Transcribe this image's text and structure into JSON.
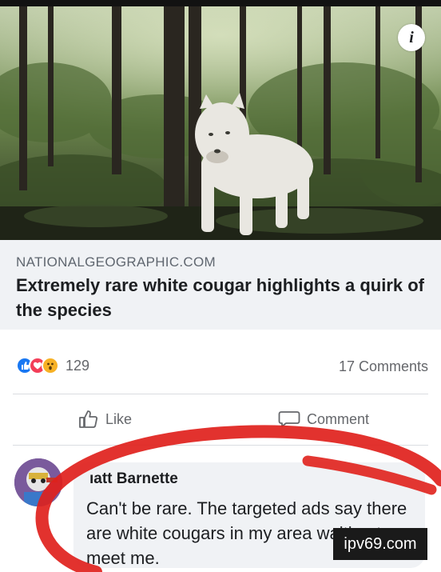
{
  "post": {
    "info_icon": "info-icon",
    "link": {
      "domain": "NATIONALGEOGRAPHIC.COM",
      "headline": "Extremely rare white cougar highlights a quirk of the species"
    },
    "reactions": {
      "icons": [
        "like-icon",
        "love-icon",
        "wow-icon"
      ],
      "count": "129"
    },
    "comments_count": "17 Comments",
    "actions": {
      "like_label": "Like",
      "comment_label": "Comment"
    }
  },
  "comment": {
    "author": "Matt Barnette",
    "author_visible": "ıatt Barnette",
    "text": "Can't be rare. The targeted ads say there are white cougars in my area waiting to meet me."
  },
  "watermark": {
    "text": "ipv69.com"
  },
  "colors": {
    "annotation_red": "#e0211c",
    "link_box_bg": "#f0f2f5",
    "muted_text": "#65676b"
  }
}
